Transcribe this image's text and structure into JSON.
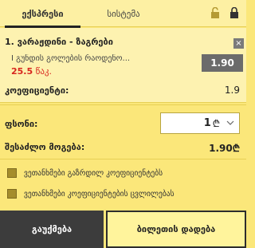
{
  "tabs": [
    {
      "label": "ექსპრესი",
      "active": true
    },
    {
      "label": "სისტემა",
      "active": false
    }
  ],
  "selection": {
    "index": "1.",
    "event": "ვარაჟდინი - ზაგრები",
    "market": "I გუნდის გოლების რაოდენო...",
    "previous_odds": "25.5",
    "previous_odds_unit": "წაკ.",
    "odds": "1.90",
    "close_symbol": "×"
  },
  "coefficient": {
    "label": "კოეფიციენტი:",
    "value": "1.9"
  },
  "stake": {
    "label": "ფსონი:",
    "value": "1",
    "currency_symbol": "₾"
  },
  "possible_win": {
    "label": "შესაძლო მოგება:",
    "value": "1.90₾"
  },
  "options": [
    {
      "label": "ვეთანხმები გაზრდილ კოეფიციენტებს",
      "checked": false
    },
    {
      "label": "ვეთანხმები კოეფიციენტების ცვლილებას",
      "checked": false
    }
  ],
  "buttons": {
    "clear": "გაუქმება",
    "place": "ბილეთის დადება"
  },
  "colors": {
    "panel_bg": "#fbe77a",
    "header_bg": "#fdf0a3",
    "odds_badge": "#6b6b6b",
    "accent_red": "#d7261e",
    "clear_button": "#3c3c3c",
    "place_button": "#fff49c"
  },
  "icons": [
    "unlock-icon",
    "lock-icon",
    "close-icon",
    "chevron-down-icon",
    "lari-currency-icon"
  ]
}
